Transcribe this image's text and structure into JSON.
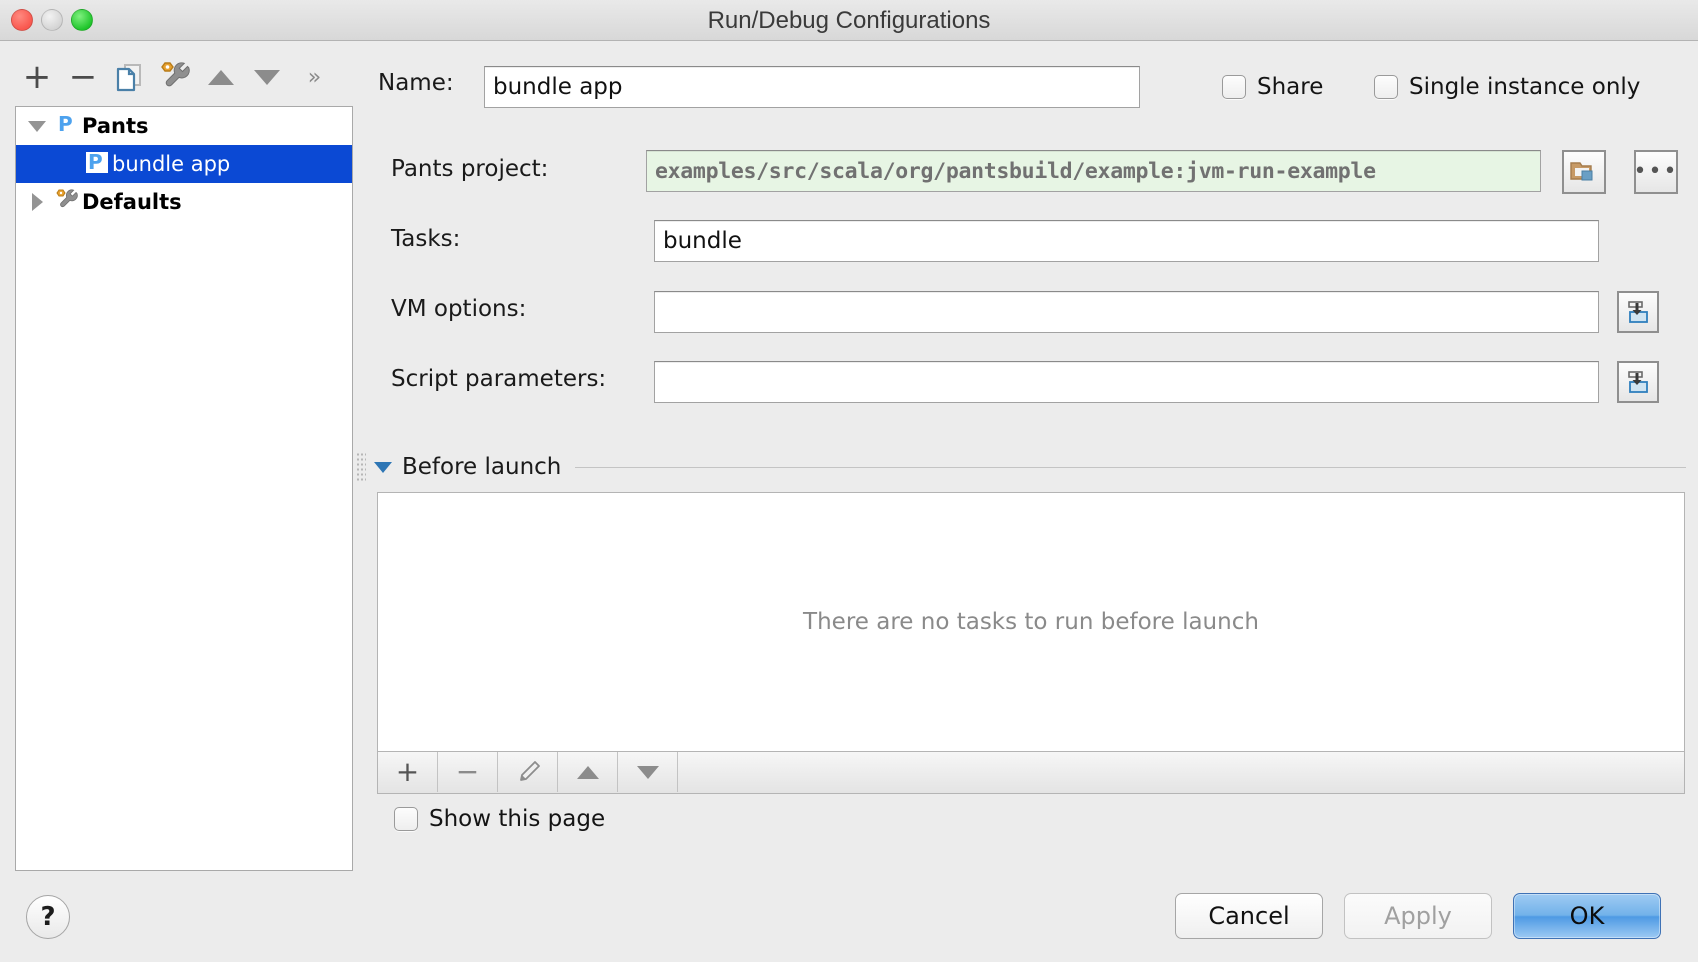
{
  "window": {
    "title": "Run/Debug Configurations",
    "controls": {
      "close": "close-button",
      "minimize": "minimize-button",
      "maximize": "maximize-button"
    }
  },
  "toolbar": {
    "add": "+",
    "remove": "−",
    "copy": "copy-icon",
    "edit_defaults": "wrench-icon",
    "move_up": "move-up-icon",
    "move_down": "move-down-icon",
    "more": "»"
  },
  "tree": {
    "nodes": [
      {
        "label": "Pants",
        "icon": "pants-icon",
        "expanded": true,
        "selected": false,
        "level": 0
      },
      {
        "label": "bundle app",
        "icon": "pants-icon",
        "expanded": null,
        "selected": true,
        "level": 1
      },
      {
        "label": "Defaults",
        "icon": "wrench-icon",
        "expanded": false,
        "selected": false,
        "level": 0
      }
    ]
  },
  "form": {
    "name_label": "Name:",
    "name_value": "bundle app",
    "share_label": "Share",
    "share_checked": false,
    "single_instance_label": "Single instance only",
    "single_instance_checked": false,
    "pants_project_label": "Pants project:",
    "pants_project_value": "examples/src/scala/org/pantsbuild/example:jvm-run-example",
    "browse_folder": "folder-icon",
    "browse_dots": "•••",
    "tasks_label": "Tasks:",
    "tasks_value": "bundle",
    "vm_options_label": "VM options:",
    "vm_options_value": "",
    "script_parameters_label": "Script parameters:",
    "script_parameters_value": "",
    "expand_icon": "expand-editor-icon"
  },
  "before_launch": {
    "title": "Before launch",
    "empty_message": "There are no tasks to run before launch",
    "toolbar": {
      "add": "+",
      "remove": "−",
      "edit": "pencil-icon",
      "move_up": "move-up-icon",
      "move_down": "move-down-icon"
    },
    "show_page_label": "Show this page",
    "show_page_checked": false
  },
  "footer": {
    "help": "?",
    "cancel": "Cancel",
    "apply": "Apply",
    "apply_enabled": false,
    "ok": "OK"
  },
  "colors": {
    "selection_blue": "#0b49d4",
    "accent_blue": "#2e76b5",
    "green_field_bg": "#e7f5e4",
    "window_bg": "#ececec"
  }
}
